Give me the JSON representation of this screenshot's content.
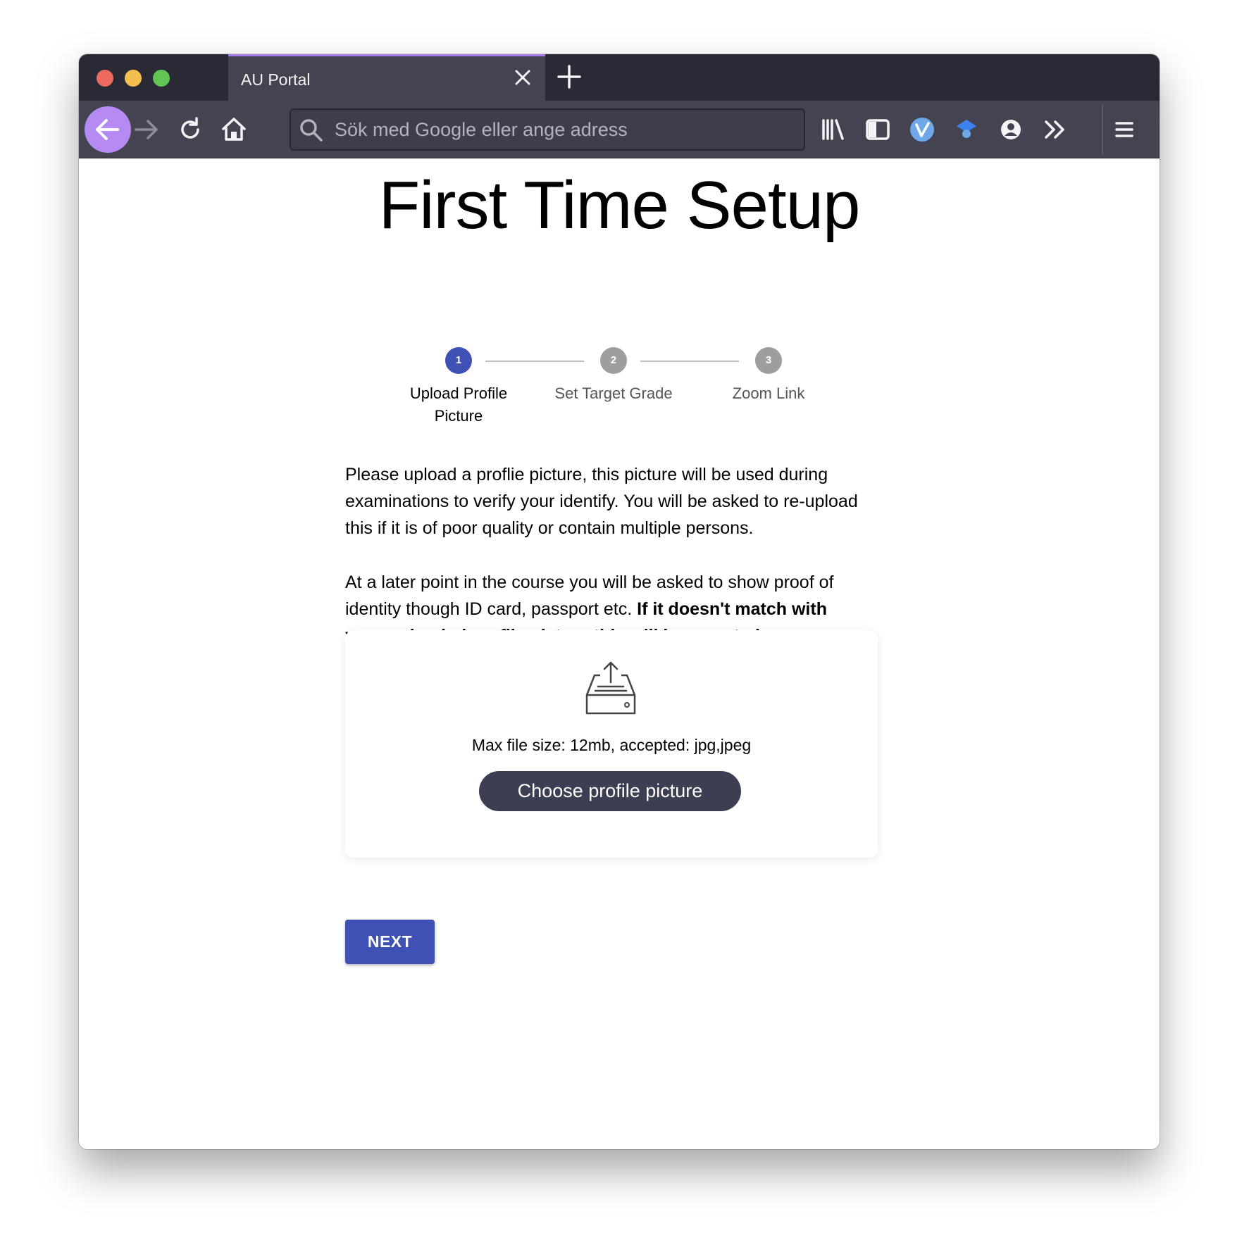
{
  "browser": {
    "tab_title": "AU Portal",
    "search_placeholder": "Sök med Google eller ange adress"
  },
  "page": {
    "title": "First Time Setup",
    "steps": [
      {
        "number": "1",
        "label": "Upload Profile Picture",
        "active": true
      },
      {
        "number": "2",
        "label": "Set Target Grade",
        "active": false
      },
      {
        "number": "3",
        "label": "Zoom Link",
        "active": false
      }
    ],
    "intro_paragraph": "Please upload a proflie picture, this picture will be used during examinations to verify your identify. You will be asked to re-upload this if it is of poor quality or contain multiple persons.",
    "notice_paragraph_start": "At a later point in the course you will be asked to show proof of identity though ID card, passport etc. ",
    "notice_paragraph_bold": "If it doesn't match with your uploaded profile picture this will be reported",
    "notice_paragraph_end": ".",
    "upload_hint": "Max file size: 12mb, accepted: jpg,jpeg",
    "choose_button_label": "Choose profile picture",
    "next_button_label": "NEXT"
  },
  "colors": {
    "step_active": "#3f51b5",
    "step_inactive": "#9e9e9e",
    "next_button": "#3f51b5",
    "choose_button": "#3c3e52",
    "tab_accent": "#a67bf0"
  }
}
